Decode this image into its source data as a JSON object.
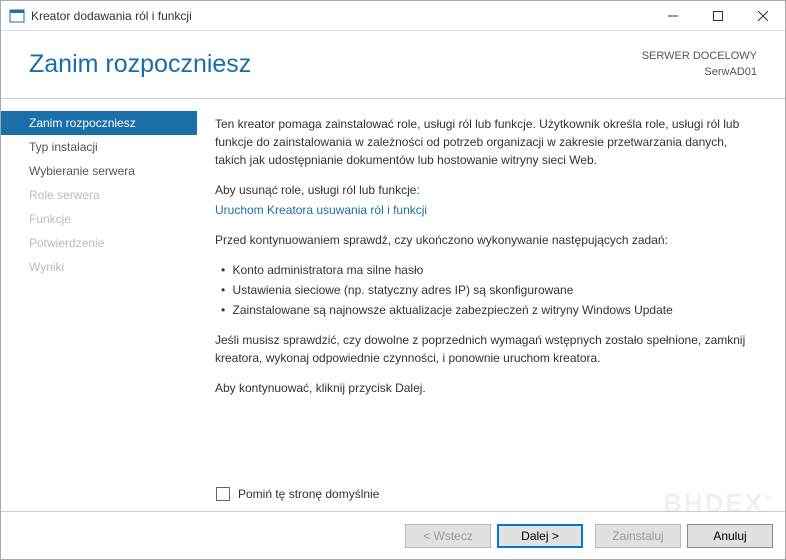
{
  "window": {
    "title": "Kreator dodawania ról i funkcji"
  },
  "header": {
    "title": "Zanim rozpoczniesz",
    "dest_label": "SERWER DOCELOWY",
    "dest_server": "SerwAD01"
  },
  "nav": {
    "items": [
      {
        "label": "Zanim rozpoczniesz",
        "state": "active"
      },
      {
        "label": "Typ instalacji",
        "state": "enabled"
      },
      {
        "label": "Wybieranie serwera",
        "state": "enabled"
      },
      {
        "label": "Role serwera",
        "state": "disabled"
      },
      {
        "label": "Funkcje",
        "state": "disabled"
      },
      {
        "label": "Potwierdzenie",
        "state": "disabled"
      },
      {
        "label": "Wyniki",
        "state": "disabled"
      }
    ]
  },
  "content": {
    "intro": "Ten kreator pomaga zainstalować role, usługi ról lub funkcje. Użytkownik określa role, usługi ról lub funkcje do zainstalowania w zależności od potrzeb organizacji w zakresie przetwarzania danych, takich jak udostępnianie dokumentów lub hostowanie witryny sieci Web.",
    "remove_label": "Aby usunąć role, usługi ról lub funkcje:",
    "remove_link": "Uruchom Kreatora usuwania ról i funkcji",
    "before_label": "Przed kontynuowaniem sprawdź, czy ukończono wykonywanie następujących zadań:",
    "checks": [
      "Konto administratora ma silne hasło",
      "Ustawienia sieciowe (np. statyczny adres IP) są skonfigurowane",
      "Zainstalowane są najnowsze aktualizacje zabezpieczeń z witryny Windows Update"
    ],
    "verify_note": "Jeśli musisz sprawdzić, czy dowolne z poprzednich wymagań wstępnych zostało spełnione, zamknij kreatora, wykonaj odpowiednie czynności, i ponownie uruchom kreatora.",
    "continue_note": "Aby kontynuować, kliknij przycisk Dalej.",
    "skip_label": "Pomiń tę stronę domyślnie"
  },
  "footer": {
    "back": "< Wstecz",
    "next": "Dalej >",
    "install": "Zainstaluj",
    "cancel": "Anuluj"
  },
  "watermark": "BHDEX"
}
